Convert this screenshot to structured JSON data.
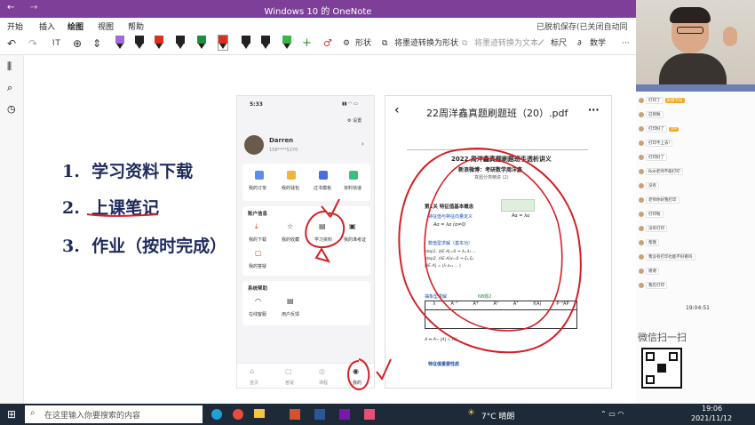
{
  "window": {
    "title": "Windows 10 的 OneNote",
    "save_status": "已脱机保存(已关闭自动同步)"
  },
  "menu": {
    "items": [
      "开始",
      "插入",
      "绘图",
      "视图",
      "帮助"
    ]
  },
  "toolbar": {
    "shape": "形状",
    "ink_to_shape": "将墨迹转换为形状",
    "ink_to_text": "将墨迹转换为文本",
    "ruler": "标尺",
    "math": "数学",
    "pen_colors": [
      "#a06bd8",
      "#222222",
      "#d93025",
      "#222222",
      "#222222",
      "#1e8e3e",
      "#d93025",
      "#222222",
      "#222222",
      "#3cb54a"
    ]
  },
  "notes": {
    "items": [
      {
        "num": "1.",
        "text": "学习资料下载"
      },
      {
        "num": "2.",
        "text": "上课笔记"
      },
      {
        "num": "3.",
        "text": "作业（按时完成）"
      }
    ]
  },
  "phone": {
    "time": "5:33",
    "settings": "设置",
    "user_name": "Darren",
    "user_phone": "158****5270",
    "row1": [
      "我的订单",
      "我的钱包",
      "过书模板",
      "资料快递"
    ],
    "account_title": "账户信息",
    "row2": [
      "我的下载",
      "我的收藏",
      "学习资料",
      "我的准考证"
    ],
    "row2b": [
      "我的答疑"
    ],
    "system_title": "系统帮助",
    "row3": [
      "在线客服",
      "用户反馈"
    ],
    "nav": [
      "首页",
      "答疑",
      "课程",
      "我的"
    ]
  },
  "pdf": {
    "title": "22周洋鑫真题刷题班（20）.pdf",
    "doc_title": "2022 周洋鑫真题刷题班手透析讲义",
    "doc_sub": "新浪微博：考研数学周洋鑫",
    "doc_sub2": "真题分类精讲 (2)",
    "sec1": "第1关 特征值基本概念",
    "sec1a": "特征值与特征向量定义",
    "sec1b": "数值型求解（基本功）",
    "sec2": "抽象型求解",
    "sec3": "特征值重要性质",
    "formula1": "Aα = λα",
    "formula2": "Aα = λα (α≠0)",
    "formula3": "A ⇔ A∼ |A| = Πλᵢ",
    "table_head": [
      "λ",
      "A⁻¹",
      "A*",
      "A²",
      "Aᵀ",
      "f(A)",
      "P⁻¹AP"
    ],
    "nb": "NB题2"
  },
  "chat": {
    "messages": [
      "打印了",
      "已到啦",
      "打印好了",
      "打印不上去!",
      "打印好了",
      "Bob老师不能打印",
      "没有",
      "老师你好我打印",
      "打印啦",
      "没有打印",
      "帮我",
      "我没有打印也能不好看吗",
      "谢谢",
      "我在打印"
    ],
    "time": "19:04:51",
    "scan_text": "微信扫一扫",
    "tags": [
      "高级学员",
      "VIP"
    ]
  },
  "taskbar": {
    "search_placeholder": "在这里输入你要搜索的内容",
    "weather": "7°C 晴朗",
    "time": "19:06",
    "date": "2021/11/12"
  },
  "colors": {
    "onenote_purple": "#7d3f98",
    "ink_red": "#d61f26",
    "taskbar": "#1f2a38"
  }
}
